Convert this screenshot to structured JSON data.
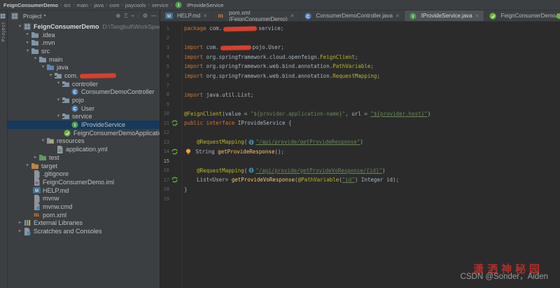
{
  "colors": {
    "window_bg": "#3c3f41",
    "editor_bg": "#2b2b2b",
    "selection_bg": "#15395c",
    "keyword": "#cc7832",
    "annotation": "#bbb529",
    "string": "#6a8759",
    "method": "#ffc66b",
    "plain_text": "#a9b7c6",
    "redaction_red": "#d8402e",
    "interface_green": "#4d9a51",
    "class_blue": "#4e7fb0",
    "spring_green": "#6DB33F"
  },
  "breadcrumb": {
    "items": [
      "FeignConsumerDemo",
      "src",
      "main",
      "java",
      "com",
      "paycools",
      "service"
    ],
    "current": {
      "icon": "interface-icon",
      "label": "IProvideService"
    }
  },
  "tool_strip": {
    "label": "Project",
    "icon": "project-tool-icon"
  },
  "project_panel": {
    "title": "Project",
    "title_icon": "project-icon",
    "caret": "▾",
    "header_icons": [
      {
        "name": "locate-file-icon",
        "glyph": "⊕"
      },
      {
        "name": "collapse-all-icon",
        "glyph": "Ξ"
      },
      {
        "name": "expand-all-icon",
        "glyph": "÷"
      },
      {
        "name": "separator",
        "glyph": "|"
      },
      {
        "name": "settings-gear-icon",
        "glyph": "⚙"
      },
      {
        "name": "hide-panel-icon",
        "glyph": "—"
      }
    ]
  },
  "tree": {
    "items": [
      {
        "depth": 0,
        "chevron": "open",
        "icon": "project-icon",
        "label": "FeignConsumerDemo",
        "bold": true,
        "path": "D:\\Tangbull\\WorkSpace\\FeignCon"
      },
      {
        "depth": 1,
        "chevron": "closed",
        "icon": "folder-icon",
        "label": ".idea"
      },
      {
        "depth": 1,
        "chevron": "closed",
        "icon": "folder-icon",
        "label": ".mvn"
      },
      {
        "depth": 1,
        "chevron": "open",
        "icon": "folder-icon",
        "label": "src"
      },
      {
        "depth": 2,
        "chevron": "open",
        "icon": "folder-icon",
        "label": "main"
      },
      {
        "depth": 3,
        "chevron": "open",
        "icon": "java-folder-icon",
        "label": "java"
      },
      {
        "depth": 4,
        "chevron": "open",
        "icon": "package-icon",
        "label": "com.",
        "redact": 52
      },
      {
        "depth": 5,
        "chevron": "open",
        "icon": "package-icon",
        "label": "controller"
      },
      {
        "depth": 6,
        "chevron": "none",
        "icon": "class-icon",
        "label": "ConsumerDemoController"
      },
      {
        "depth": 5,
        "chevron": "open",
        "icon": "package-icon",
        "label": "pojo"
      },
      {
        "depth": 6,
        "chevron": "none",
        "icon": "class-icon",
        "label": "User"
      },
      {
        "depth": 5,
        "chevron": "open",
        "icon": "package-icon",
        "label": "service"
      },
      {
        "depth": 6,
        "chevron": "none",
        "icon": "interface-icon",
        "label": "IProvideService",
        "selected": true
      },
      {
        "depth": 5,
        "chevron": "none",
        "icon": "spring-boot-icon",
        "label": "FeignConsumerDemoApplication"
      },
      {
        "depth": 3,
        "chevron": "open",
        "icon": "resources-folder-icon",
        "label": "resources"
      },
      {
        "depth": 4,
        "chevron": "none",
        "icon": "yml-icon",
        "label": "application.yml"
      },
      {
        "depth": 2,
        "chevron": "closed",
        "icon": "test-folder-icon",
        "label": "test"
      },
      {
        "depth": 1,
        "chevron": "closed",
        "icon": "target-folder-icon",
        "label": "target"
      },
      {
        "depth": 1,
        "chevron": "none",
        "icon": "git-icon",
        "label": ".gitignore"
      },
      {
        "depth": 1,
        "chevron": "none",
        "icon": "iml-icon",
        "label": "FeignConsumerDemo.iml"
      },
      {
        "depth": 1,
        "chevron": "none",
        "icon": "markdown-icon",
        "label": "HELP.md"
      },
      {
        "depth": 1,
        "chevron": "none",
        "icon": "file-icon",
        "label": "mvnw"
      },
      {
        "depth": 1,
        "chevron": "none",
        "icon": "cmd-icon",
        "label": "mvnw.cmd"
      },
      {
        "depth": 1,
        "chevron": "none",
        "icon": "maven-icon",
        "label": "pom.xml"
      },
      {
        "depth": 0,
        "chevron": "closed",
        "icon": "libraries-icon",
        "label": "External Libraries"
      },
      {
        "depth": 0,
        "chevron": "closed",
        "icon": "scratches-icon",
        "label": "Scratches and Consoles"
      }
    ]
  },
  "tabs": [
    {
      "icon": "markdown-icon",
      "label": "HELP.md",
      "selected": false
    },
    {
      "icon": "maven-icon",
      "label": "pom.xml (FeignConsumerDemo)",
      "selected": false
    },
    {
      "icon": "class-icon",
      "label": "ConsumerDemoController.java",
      "selected": false
    },
    {
      "icon": "interface-icon",
      "label": "IProvideService.java",
      "selected": true
    },
    {
      "icon": "spring-boot-icon",
      "label": "FeignConsumerDemoApplication.java",
      "selected": false
    }
  ],
  "editor": {
    "lines": [
      {
        "num": 1,
        "segments": [
          {
            "s": "kw",
            "t": "package "
          },
          {
            "s": "pl",
            "t": "com."
          },
          {
            "r": 48
          },
          {
            "s": "pl",
            "t": "service;"
          }
        ]
      },
      {
        "num": 2,
        "segments": []
      },
      {
        "num": 3,
        "segments": [
          {
            "s": "kw",
            "t": "import "
          },
          {
            "s": "pl",
            "t": "com."
          },
          {
            "r": 44
          },
          {
            "s": "pl",
            "t": "pojo.User;"
          }
        ]
      },
      {
        "num": 4,
        "segments": [
          {
            "s": "kw",
            "t": "import "
          },
          {
            "s": "pl",
            "t": "org.springframework.cloud.openfeign."
          },
          {
            "s": "an",
            "t": "FeignClient"
          },
          {
            "s": "pl",
            "t": ";"
          }
        ]
      },
      {
        "num": 5,
        "segments": [
          {
            "s": "kw",
            "t": "import "
          },
          {
            "s": "pl",
            "t": "org.springframework.web.bind.annotation."
          },
          {
            "s": "an",
            "t": "PathVariable"
          },
          {
            "s": "pl",
            "t": ";"
          }
        ]
      },
      {
        "num": 6,
        "segments": [
          {
            "s": "kw",
            "t": "import "
          },
          {
            "s": "pl",
            "t": "org.springframework.web.bind.annotation."
          },
          {
            "s": "an",
            "t": "RequestMapping"
          },
          {
            "s": "pl",
            "t": ";"
          }
        ]
      },
      {
        "num": 7,
        "segments": []
      },
      {
        "num": 8,
        "segments": [
          {
            "s": "kw",
            "t": "import "
          },
          {
            "s": "pl",
            "t": "java.util.List;"
          }
        ]
      },
      {
        "num": 9,
        "segments": []
      },
      {
        "num": 10,
        "segments": [
          {
            "s": "an",
            "t": "@FeignClient"
          },
          {
            "s": "pl",
            "t": "(value = "
          },
          {
            "s": "st",
            "t": "\"${provider.application-name}\""
          },
          {
            "s": "pl",
            "t": ", url = "
          },
          {
            "s": "sl",
            "t": "\"${provider.host}\""
          },
          {
            "s": "pl",
            "t": ")"
          }
        ]
      },
      {
        "num": 11,
        "gutter_icon": "spring-bean-icon",
        "segments": [
          {
            "s": "kw",
            "t": "public interface "
          },
          {
            "s": "pl",
            "t": "IProvideService {"
          }
        ]
      },
      {
        "num": 12,
        "segments": []
      },
      {
        "num": 13,
        "segments": [
          {
            "s": "pl",
            "t": "    "
          },
          {
            "s": "an",
            "t": "@RequestMapping"
          },
          {
            "s": "pl",
            "t": "("
          },
          {
            "i": "globe-icon"
          },
          {
            "s": "sl",
            "t": "\"/api/provide/getProvideResponse\""
          },
          {
            "s": "pl",
            "t": ")"
          }
        ]
      },
      {
        "num": 14,
        "gutter_icon": "spring-bean-icon",
        "segments": [
          {
            "i": "bulb-icon"
          },
          {
            "s": "pl",
            "t": " String "
          },
          {
            "s": "mt",
            "t": "getProvideResponse"
          },
          {
            "s": "pl",
            "t": "();"
          }
        ]
      },
      {
        "num": 15,
        "caret": true,
        "segments": []
      },
      {
        "num": 16,
        "segments": [
          {
            "s": "pl",
            "t": "    "
          },
          {
            "s": "an",
            "t": "@RequestMapping"
          },
          {
            "s": "pl",
            "t": "("
          },
          {
            "i": "globe-icon"
          },
          {
            "s": "sl",
            "t": "\"/api/provide/getProvideVoResponse/{id}\""
          },
          {
            "s": "pl",
            "t": ")"
          }
        ]
      },
      {
        "num": 17,
        "gutter_icon": "spring-bean-icon",
        "segments": [
          {
            "s": "pl",
            "t": "    List<User> "
          },
          {
            "s": "mt",
            "t": "getProvideVoResponse"
          },
          {
            "s": "pl",
            "t": "("
          },
          {
            "s": "an",
            "t": "@PathVariable"
          },
          {
            "s": "pl",
            "t": "("
          },
          {
            "s": "sl",
            "t": "\"id\""
          },
          {
            "s": "pl",
            "t": ") Integer id);"
          }
        ]
      },
      {
        "num": 18,
        "segments": [
          {
            "s": "pl",
            "t": "}"
          }
        ]
      },
      {
        "num": 19,
        "segments": []
      }
    ]
  },
  "watermark": {
    "red_text": "潇洒神秘园",
    "gray_text": "CSDN @Sonder，Aiden"
  }
}
